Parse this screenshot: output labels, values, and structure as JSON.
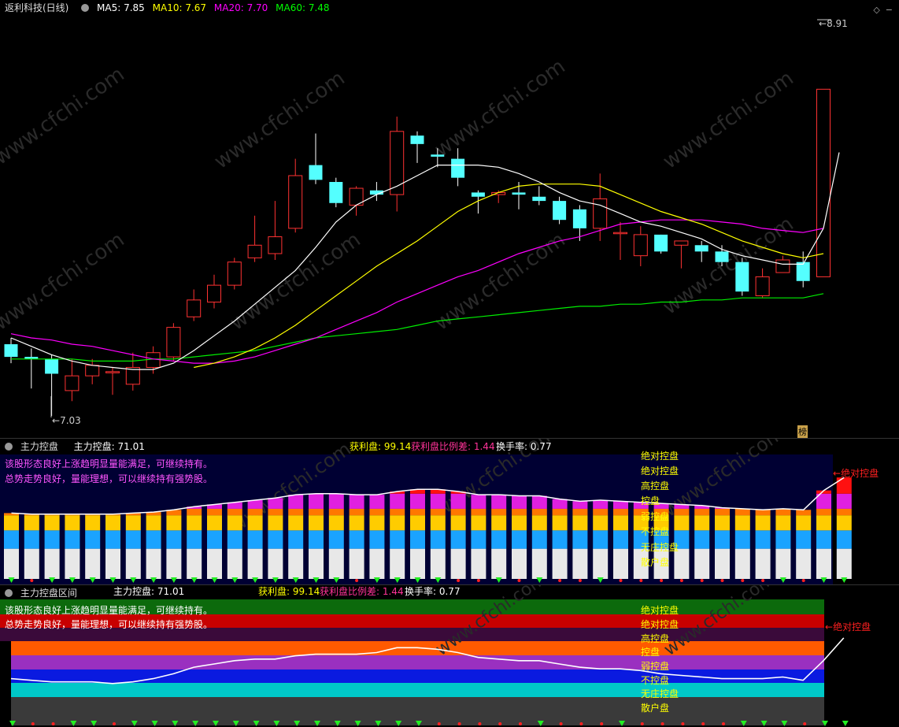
{
  "pane1": {
    "title": "返利科技(日线)",
    "ma_labels": [
      {
        "label": "MA5: 7.85",
        "color": "#ffffff"
      },
      {
        "label": "MA10: 7.67",
        "color": "#ffff00"
      },
      {
        "label": "MA20: 7.70",
        "color": "#ff00ff"
      },
      {
        "label": "MA60: 7.48",
        "color": "#00ff00"
      }
    ],
    "high_label": "8.91",
    "low_label": "7.03",
    "bang_label": "榜",
    "watermark": "www.cfchi.com"
  },
  "pane2": {
    "title": "主力控盘",
    "main_label": "主力控盘: 71.01",
    "profit_label": "获利盘: 99.14",
    "profit_diff_label": "获利盘比例差: 1.44",
    "turnover_label": "换手率: 0.77",
    "desc1": "该股形态良好上涨趋明显量能满足，可继续持有。",
    "desc2": "总势走势良好，量能理想，可以继续持有强势股。",
    "levels": [
      "绝对控盘",
      "绝对控盘",
      "高控盘",
      "控盘",
      "弱控盘",
      "不控盘",
      "无庄控盘",
      "散户盘"
    ],
    "arrow_label": "绝对控盘"
  },
  "pane3": {
    "title": "主力控盘区间",
    "main_label": "主力控盘: 71.01",
    "profit_label": "获利盘: 99.14",
    "profit_diff_label": "获利盘比例差: 1.44",
    "turnover_label": "换手率: 0.77",
    "desc1": "该股形态良好上涨趋明显量能满足，可继续持有。",
    "desc2": "总势走势良好，量能理想，可以继续持有强势股。",
    "levels": [
      "绝对控盘",
      "绝对控盘",
      "高控盘",
      "控盘",
      "弱控盘",
      "不控盘",
      "无庄控盘",
      "散户盘"
    ],
    "arrow_label": "绝对控盘"
  },
  "chart_data": [
    {
      "type": "candlestick",
      "title": "返利科技(日线)",
      "ylim": [
        6.9,
        9.0
      ],
      "candles": [
        {
          "o": 7.37,
          "h": 7.4,
          "l": 7.28,
          "c": 7.31
        },
        {
          "o": 7.31,
          "h": 7.35,
          "l": 7.16,
          "c": 7.3
        },
        {
          "o": 7.3,
          "h": 7.32,
          "l": 7.03,
          "c": 7.23
        },
        {
          "o": 7.15,
          "h": 7.3,
          "l": 7.1,
          "c": 7.22
        },
        {
          "o": 7.22,
          "h": 7.3,
          "l": 7.18,
          "c": 7.27
        },
        {
          "o": 7.24,
          "h": 7.26,
          "l": 7.13,
          "c": 7.24
        },
        {
          "o": 7.18,
          "h": 7.33,
          "l": 7.15,
          "c": 7.26
        },
        {
          "o": 7.26,
          "h": 7.36,
          "l": 7.23,
          "c": 7.33
        },
        {
          "o": 7.31,
          "h": 7.47,
          "l": 7.29,
          "c": 7.45
        },
        {
          "o": 7.5,
          "h": 7.63,
          "l": 7.48,
          "c": 7.58
        },
        {
          "o": 7.57,
          "h": 7.7,
          "l": 7.54,
          "c": 7.65
        },
        {
          "o": 7.65,
          "h": 7.78,
          "l": 7.63,
          "c": 7.76
        },
        {
          "o": 7.78,
          "h": 7.98,
          "l": 7.76,
          "c": 7.84
        },
        {
          "o": 7.8,
          "h": 8.05,
          "l": 7.77,
          "c": 7.88
        },
        {
          "o": 7.92,
          "h": 8.25,
          "l": 7.9,
          "c": 8.17
        },
        {
          "o": 8.22,
          "h": 8.37,
          "l": 8.13,
          "c": 8.15
        },
        {
          "o": 8.14,
          "h": 8.16,
          "l": 8.02,
          "c": 8.04
        },
        {
          "o": 8.03,
          "h": 8.12,
          "l": 7.98,
          "c": 8.11
        },
        {
          "o": 8.1,
          "h": 8.14,
          "l": 8.05,
          "c": 8.08
        },
        {
          "o": 8.08,
          "h": 8.45,
          "l": 8.0,
          "c": 8.38
        },
        {
          "o": 8.36,
          "h": 8.38,
          "l": 8.23,
          "c": 8.32
        },
        {
          "o": 8.27,
          "h": 8.3,
          "l": 8.21,
          "c": 8.26
        },
        {
          "o": 8.25,
          "h": 8.3,
          "l": 8.12,
          "c": 8.16
        },
        {
          "o": 8.09,
          "h": 8.1,
          "l": 7.99,
          "c": 8.07
        },
        {
          "o": 8.08,
          "h": 8.1,
          "l": 8.04,
          "c": 8.09
        },
        {
          "o": 8.09,
          "h": 8.14,
          "l": 8.01,
          "c": 8.08
        },
        {
          "o": 8.07,
          "h": 8.12,
          "l": 8.03,
          "c": 8.05
        },
        {
          "o": 8.05,
          "h": 8.07,
          "l": 7.94,
          "c": 7.96
        },
        {
          "o": 8.01,
          "h": 8.03,
          "l": 7.86,
          "c": 7.92
        },
        {
          "o": 7.92,
          "h": 8.18,
          "l": 7.86,
          "c": 8.06
        },
        {
          "o": 7.9,
          "h": 7.95,
          "l": 7.77,
          "c": 7.9
        },
        {
          "o": 7.79,
          "h": 7.93,
          "l": 7.74,
          "c": 7.89
        },
        {
          "o": 7.89,
          "h": 7.89,
          "l": 7.8,
          "c": 7.81
        },
        {
          "o": 7.84,
          "h": 7.86,
          "l": 7.73,
          "c": 7.86
        },
        {
          "o": 7.84,
          "h": 7.86,
          "l": 7.76,
          "c": 7.81
        },
        {
          "o": 7.81,
          "h": 7.84,
          "l": 7.74,
          "c": 7.76
        },
        {
          "o": 7.76,
          "h": 7.78,
          "l": 7.6,
          "c": 7.62
        },
        {
          "o": 7.6,
          "h": 7.73,
          "l": 7.59,
          "c": 7.69
        },
        {
          "o": 7.71,
          "h": 7.79,
          "l": 7.72,
          "c": 7.77
        },
        {
          "o": 7.76,
          "h": 7.81,
          "l": 7.64,
          "c": 7.67
        },
        {
          "o": 7.69,
          "h": 8.58,
          "l": 7.69,
          "c": 8.58
        }
      ],
      "ma5": [
        7.4,
        7.36,
        7.32,
        7.29,
        7.27,
        7.26,
        7.25,
        7.25,
        7.28,
        7.34,
        7.41,
        7.48,
        7.56,
        7.64,
        7.72,
        7.83,
        7.95,
        8.03,
        8.08,
        8.12,
        8.17,
        8.22,
        8.22,
        8.22,
        8.21,
        8.18,
        8.14,
        8.09,
        8.05,
        8.03,
        7.99,
        7.95,
        7.93,
        7.9,
        7.87,
        7.82,
        7.79,
        7.77,
        7.75,
        7.75,
        7.92
      ],
      "ma10": [
        null,
        null,
        null,
        null,
        null,
        null,
        null,
        null,
        null,
        7.26,
        7.28,
        7.31,
        7.35,
        7.4,
        7.46,
        7.53,
        7.6,
        7.67,
        7.74,
        7.8,
        7.86,
        7.93,
        8.0,
        8.05,
        8.09,
        8.12,
        8.13,
        8.13,
        8.13,
        8.12,
        8.08,
        8.04,
        8.0,
        7.97,
        7.94,
        7.9,
        7.86,
        7.83,
        7.8,
        7.78,
        7.8
      ],
      "ma20": [
        7.42,
        7.4,
        7.39,
        7.37,
        7.36,
        7.34,
        7.32,
        7.3,
        7.29,
        7.28,
        7.28,
        7.29,
        7.31,
        7.34,
        7.37,
        7.4,
        7.44,
        7.48,
        7.52,
        7.57,
        7.61,
        7.65,
        7.69,
        7.72,
        7.76,
        7.8,
        7.83,
        7.86,
        7.88,
        7.91,
        7.94,
        7.95,
        7.96,
        7.96,
        7.96,
        7.95,
        7.94,
        7.92,
        7.91,
        7.9,
        7.92
      ],
      "ma60": [
        7.3,
        7.3,
        7.3,
        7.3,
        7.29,
        7.29,
        7.29,
        7.3,
        7.3,
        7.31,
        7.32,
        7.33,
        7.34,
        7.36,
        7.38,
        7.4,
        7.41,
        7.42,
        7.43,
        7.44,
        7.46,
        7.48,
        7.49,
        7.5,
        7.51,
        7.52,
        7.53,
        7.54,
        7.55,
        7.55,
        7.56,
        7.56,
        7.57,
        7.57,
        7.58,
        7.58,
        7.59,
        7.59,
        7.59,
        7.59,
        7.61
      ],
      "extra_line_end": [
        7.92,
        8.28
      ]
    },
    {
      "type": "bar",
      "title": "主力控盘",
      "series_values": [
        61,
        60,
        60,
        60,
        60,
        60,
        61,
        62,
        64,
        67,
        69,
        71,
        73,
        75,
        78,
        79,
        79,
        78,
        78,
        81,
        83,
        83,
        81,
        78,
        78,
        77,
        77,
        74,
        72,
        73,
        72,
        71,
        70,
        69,
        68,
        66,
        65,
        64,
        65,
        64,
        82,
        94
      ]
    },
    {
      "type": "line",
      "title": "主力控盘区间",
      "values": [
        60,
        59,
        58,
        58,
        58,
        57,
        58,
        60,
        63,
        67,
        69,
        71,
        72,
        72,
        74,
        75,
        75,
        75,
        76,
        79,
        79,
        78,
        76,
        73,
        72,
        71,
        71,
        69,
        67,
        66,
        66,
        65,
        63,
        62,
        61,
        60,
        60,
        60,
        61,
        59,
        71,
        85
      ]
    }
  ]
}
